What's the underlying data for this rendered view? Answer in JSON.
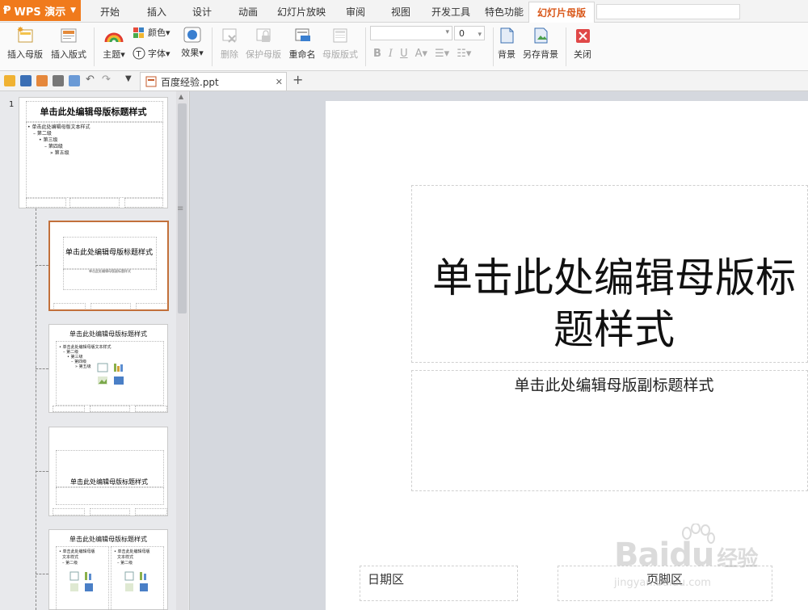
{
  "app": {
    "name": "WPS 演示"
  },
  "menu": {
    "tabs": [
      "开始",
      "插入",
      "设计",
      "动画",
      "幻灯片放映",
      "审阅",
      "视图",
      "开发工具",
      "特色功能",
      "幻灯片母版"
    ],
    "active_tab": "幻灯片母版"
  },
  "ribbon": {
    "insert_master": "插入母版",
    "insert_layout": "插入版式",
    "theme": "主题",
    "color": "颜色",
    "font": "字体",
    "effect": "效果",
    "delete": "删除",
    "protect_master": "保护母版",
    "rename": "重命名",
    "master_layout": "母版版式",
    "font_size": "0",
    "bold": "B",
    "italic": "I",
    "underline": "U",
    "font_color": "A",
    "background": "背景",
    "save_background": "另存背景",
    "close": "关闭"
  },
  "document": {
    "tab_name": "百度经验.ppt"
  },
  "thumbnails": {
    "master_number": "1",
    "master_title": "单击此处编辑母版标题样式",
    "master_text_lines": [
      "• 单击此处编辑母版文本样式",
      "– 第二级",
      "• 第三级",
      "– 第四级",
      "» 第五级"
    ],
    "title_layout": "单击此处编辑母版标题样式",
    "title_layout_sub": "单击此处编辑母版副标题样式",
    "content_layout_title": "单击此处编辑母版标题样式",
    "content_layout_lines": [
      "• 单击此处编辑母版文本样式",
      "– 第二级",
      "• 第三级",
      "– 第四级",
      "» 第五级"
    ],
    "section_layout_title": "单击此处编辑母版标题样式",
    "two_content_title": "单击此处编辑母版标题样式",
    "two_content_col": [
      "• 单击此处编辑母版",
      "文本样式",
      "– 第二级"
    ]
  },
  "slide": {
    "title": "单击此处编辑母版标题样式",
    "subtitle": "单击此处编辑母版副标题样式",
    "date_placeholder": "日期区",
    "footer_placeholder": "页脚区"
  },
  "watermark": {
    "brand": "Baidu",
    "brand_cn": "经验",
    "url": "jingyan.baidu.com"
  },
  "colors": {
    "accent": "#f07a1c",
    "active_tab": "#d9581a",
    "selected_thumb": "#c2703b"
  }
}
